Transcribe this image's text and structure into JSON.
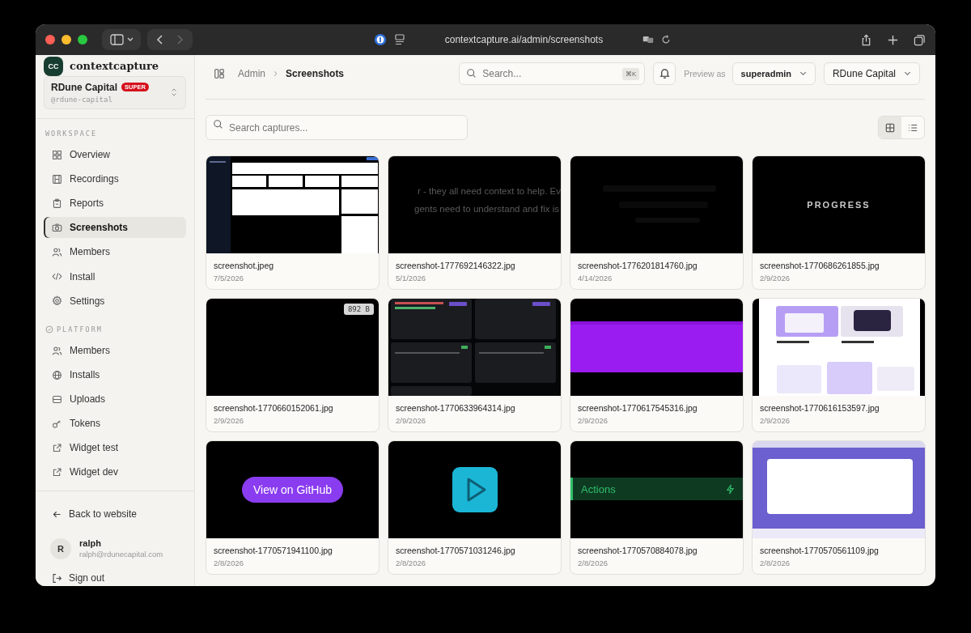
{
  "browser": {
    "url": "contextcapture.ai/admin/screenshots"
  },
  "sidebar": {
    "logo": {
      "initials": "CC",
      "name": "contextcapture"
    },
    "org": {
      "name": "RDune Capital",
      "badge": "SUPER",
      "handle": "@rdune-capital"
    },
    "sections": [
      {
        "title": "WORKSPACE",
        "kind": "plain",
        "items": [
          {
            "label": "Overview",
            "kind": "grid",
            "selected": false
          },
          {
            "label": "Recordings",
            "kind": "film",
            "selected": false
          },
          {
            "label": "Reports",
            "kind": "clipboard",
            "selected": false
          },
          {
            "label": "Screenshots",
            "kind": "camera",
            "selected": true
          },
          {
            "label": "Members",
            "kind": "users",
            "selected": false
          },
          {
            "label": "Install",
            "kind": "code",
            "selected": false
          },
          {
            "label": "Settings",
            "kind": "gear",
            "selected": false
          }
        ]
      },
      {
        "title": "PLATFORM",
        "kind": "shield",
        "items": [
          {
            "label": "Members",
            "kind": "users",
            "selected": false
          },
          {
            "label": "Installs",
            "kind": "globe",
            "selected": false
          },
          {
            "label": "Uploads",
            "kind": "tray",
            "selected": false
          },
          {
            "label": "Tokens",
            "kind": "key",
            "selected": false
          },
          {
            "label": "Widget test",
            "kind": "external",
            "selected": false
          },
          {
            "label": "Widget dev",
            "kind": "external",
            "selected": false
          }
        ]
      }
    ],
    "back_link": "Back to website",
    "user": {
      "initial": "R",
      "name": "ralph",
      "email": "ralph@rdunecapital.com"
    },
    "sign_out": "Sign out"
  },
  "header": {
    "breadcrumb": [
      "Admin",
      "Screenshots"
    ],
    "search": {
      "placeholder": "Search...",
      "shortcut": "⌘K"
    },
    "preview_label": "Preview as",
    "role": "superadmin",
    "org": "RDune Capital"
  },
  "toolbar": {
    "search": {
      "placeholder": "Search captures..."
    },
    "views": [
      {
        "kind": "grid",
        "selected": true
      },
      {
        "kind": "list",
        "selected": false
      }
    ]
  },
  "captures": [
    {
      "name": "screenshot.jpeg",
      "date": "7/5/2026",
      "thumb": {
        "kind": "dashboard"
      }
    },
    {
      "name": "screenshot-1777692146322.jpg",
      "date": "5/1/2026",
      "thumb": {
        "kind": "caption",
        "lines": [
          "r - they all need context to help. Ev",
          "gents need to understand and fix is"
        ]
      }
    },
    {
      "name": "screenshot-1776201814760.jpg",
      "date": "4/14/2026",
      "thumb": {
        "kind": "dark"
      }
    },
    {
      "name": "screenshot-1770686261855.jpg",
      "date": "2/9/2026",
      "thumb": {
        "kind": "label",
        "text": "PROGRESS"
      }
    },
    {
      "name": "screenshot-1770660152061.jpg",
      "date": "2/9/2026",
      "thumb": {
        "kind": "badge",
        "text": "892 B"
      }
    },
    {
      "name": "screenshot-1770633964314.jpg",
      "date": "2/9/2026",
      "thumb": {
        "kind": "cards"
      }
    },
    {
      "name": "screenshot-1770617545316.jpg",
      "date": "2/9/2026",
      "thumb": {
        "kind": "band"
      }
    },
    {
      "name": "screenshot-1770616153597.jpg",
      "date": "2/9/2026",
      "thumb": {
        "kind": "gallery"
      }
    },
    {
      "name": "screenshot-1770571941100.jpg",
      "date": "2/8/2026",
      "thumb": {
        "kind": "pill",
        "text": "View on GitHub"
      }
    },
    {
      "name": "screenshot-1770571031246.jpg",
      "date": "2/8/2026",
      "thumb": {
        "kind": "play"
      }
    },
    {
      "name": "screenshot-1770570884078.jpg",
      "date": "2/8/2026",
      "thumb": {
        "kind": "actions",
        "text": "Actions"
      }
    },
    {
      "name": "screenshot-1770570561109.jpg",
      "date": "2/8/2026",
      "thumb": {
        "kind": "blurred"
      }
    }
  ]
}
